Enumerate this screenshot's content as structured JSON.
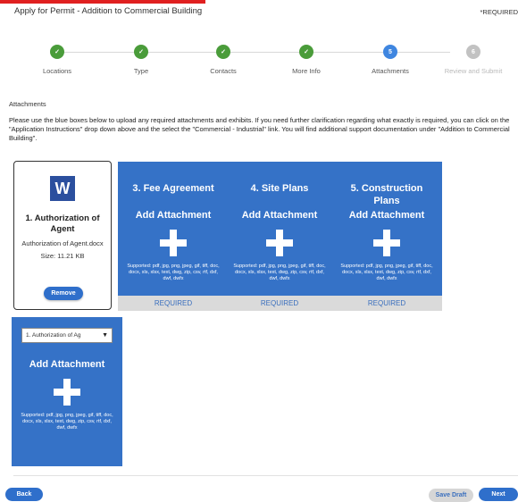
{
  "header": {
    "title": "Apply for Permit - Addition to Commercial Building",
    "required_text": "*REQUIRED"
  },
  "steps": [
    {
      "label": "Locations",
      "status": "done",
      "icon": "check-icon"
    },
    {
      "label": "Type",
      "status": "done",
      "icon": "check-icon"
    },
    {
      "label": "Contacts",
      "status": "done",
      "icon": "check-icon"
    },
    {
      "label": "More Info",
      "status": "done",
      "icon": "check-icon"
    },
    {
      "label": "Attachments",
      "status": "current",
      "number": "5"
    },
    {
      "label": "Review and Submit",
      "status": "future",
      "number": "6"
    }
  ],
  "section": {
    "title": "Attachments",
    "instructions": "Please use the blue boxes below to upload any required attachments and exhibits. If you need further clarification regarding what exactly is required, you can click on the \"Application Instructions\" drop down above and the select the \"Commercial - Industrial\" link. You will find additional support documentation under \"Addition to Commercial Building\"."
  },
  "uploaded": {
    "title": "1. Authorization of Agent",
    "filename": "Authorization of Agent.docx",
    "size": "Size: 11.21 KB",
    "icon_letter": "W",
    "remove_label": "Remove"
  },
  "cards": [
    {
      "title": "3. Fee Agreement",
      "add_label": "Add Attachment",
      "supported": "Supported: pdf, jpg, png, jpeg, gif, tiff, doc, docx, xls, xlsx, text, dwg, zip, csv, rtf, dxf, dwf, dwfx",
      "required": "REQUIRED"
    },
    {
      "title": "4. Site Plans",
      "add_label": "Add Attachment",
      "supported": "Supported: pdf, jpg, png, jpeg, gif, tiff, doc, docx, xls, xlsx, text, dwg, zip, csv, rtf, dxf, dwf, dwfx",
      "required": "REQUIRED"
    },
    {
      "title": "5. Construction Plans",
      "add_label": "Add Attachment",
      "supported": "Supported: pdf, jpg, png, jpeg, gif, tiff, doc, docx, xls, xlsx, text, dwg, zip, csv, rtf, dxf, dwf, dwfx",
      "required": "REQUIRED"
    }
  ],
  "extra_card": {
    "select_value": "1. Authorization of Ag",
    "add_label": "Add Attachment",
    "supported": "Supported: pdf, jpg, png, jpeg, gif, tiff, doc, docx, xls, xlsx, text, dwg, zip, csv, rtf, dxf, dwf, dwfx"
  },
  "footer": {
    "back": "Back",
    "save_draft": "Save Draft",
    "next": "Next"
  },
  "colors": {
    "card_blue": "#3572c7",
    "done_green": "#4a9c3a",
    "current_blue": "#3f86e0",
    "button_blue": "#2f6fcb"
  }
}
